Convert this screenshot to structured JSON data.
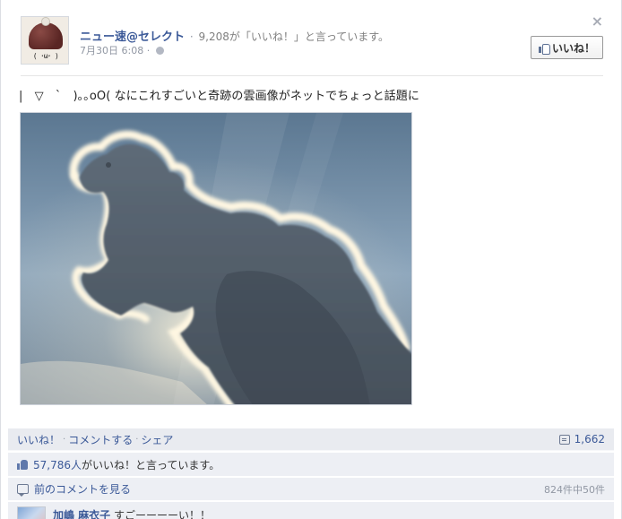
{
  "post": {
    "close_label": "×",
    "page_name": "ニュー速@セレクト",
    "separator": "·",
    "likes_summary": "9,208が「いいね！」と言っています。",
    "date": "7月30日 6:08",
    "date_separator": "·",
    "like_button_label": "いいね！",
    "avatar_face_text": "( ･ω･ )",
    "message": "|　▽　`　)｡｡oO( なにこれすごいと奇跡の雲画像がネットでちょっと話題に"
  },
  "actions": {
    "like": "いいね！",
    "comment": "コメントする",
    "share": "シェア",
    "separator": "·",
    "comment_count": "1,662"
  },
  "likes_row": {
    "count_text": "57,786人",
    "suffix": "がいいね！と言っています。"
  },
  "comments": {
    "previous_label": "前のコメントを見る",
    "count_of": "824件中50件",
    "first": {
      "author": "加嶋 麻衣子",
      "text": "すごーーーーい！！"
    }
  },
  "colors": {
    "link": "#3b5998",
    "meta_gray": "#9197a3",
    "ufi_background": "#edeff4"
  },
  "icons": {
    "close": "close-icon",
    "like_page": "thumbs-up-icon",
    "privacy": "globe-icon",
    "comments": "comment-bubble-icon",
    "likes": "thumbs-up-icon",
    "previous": "chat-icon"
  }
}
